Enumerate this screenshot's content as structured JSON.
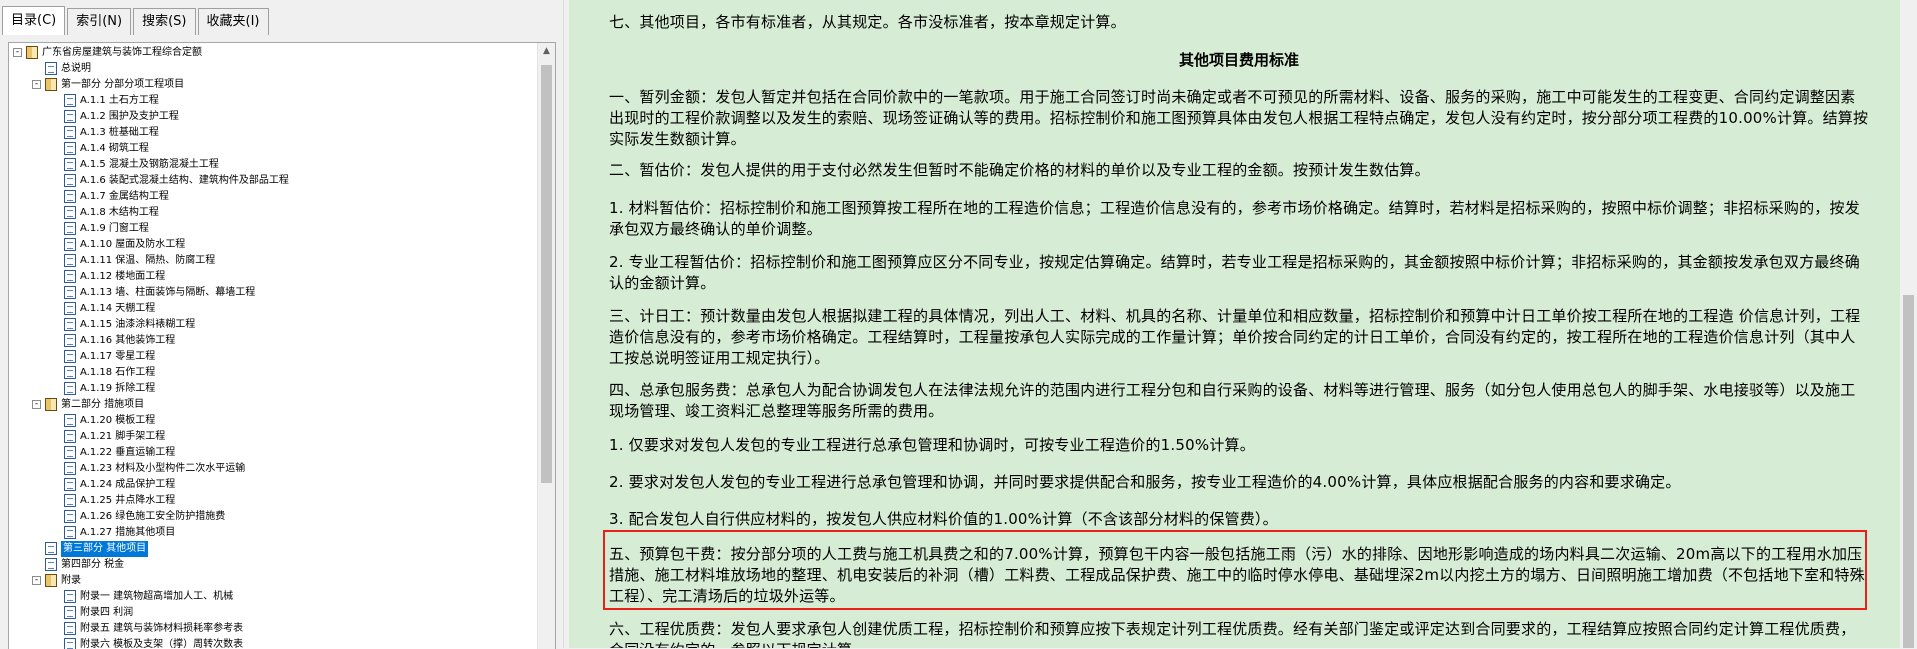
{
  "tabs": [
    {
      "label": "目录(C)"
    },
    {
      "label": "索引(N)"
    },
    {
      "label": "搜索(S)"
    },
    {
      "label": "收藏夹(I)"
    }
  ],
  "tree": [
    {
      "label": "广东省房屋建筑与装饰工程综合定额",
      "icon": "book",
      "expander": "-"
    },
    {
      "label": "总说明",
      "icon": "doc"
    },
    {
      "label": "第一部分 分部分项工程项目",
      "icon": "book",
      "expander": "-"
    },
    {
      "label": "A.1.1 土石方工程",
      "icon": "doc"
    },
    {
      "label": "A.1.2 围护及支护工程",
      "icon": "doc"
    },
    {
      "label": "A.1.3 桩基础工程",
      "icon": "doc"
    },
    {
      "label": "A.1.4 砌筑工程",
      "icon": "doc"
    },
    {
      "label": "A.1.5 混凝土及钢筋混凝土工程",
      "icon": "doc"
    },
    {
      "label": "A.1.6 装配式混凝土结构、建筑构件及部品工程",
      "icon": "doc"
    },
    {
      "label": "A.1.7 金属结构工程",
      "icon": "doc"
    },
    {
      "label": "A.1.8 木结构工程",
      "icon": "doc"
    },
    {
      "label": "A.1.9 门窗工程",
      "icon": "doc"
    },
    {
      "label": "A.1.10 屋面及防水工程",
      "icon": "doc"
    },
    {
      "label": "A.1.11 保温、隔热、防腐工程",
      "icon": "doc"
    },
    {
      "label": "A.1.12 楼地面工程",
      "icon": "doc"
    },
    {
      "label": "A.1.13 墙、柱面装饰与隔断、幕墙工程",
      "icon": "doc"
    },
    {
      "label": "A.1.14 天棚工程",
      "icon": "doc"
    },
    {
      "label": "A.1.15 油漆涂料裱糊工程",
      "icon": "doc"
    },
    {
      "label": "A.1.16 其他装饰工程",
      "icon": "doc"
    },
    {
      "label": "A.1.17 零星工程",
      "icon": "doc"
    },
    {
      "label": "A.1.18 石作工程",
      "icon": "doc"
    },
    {
      "label": "A.1.19 拆除工程",
      "icon": "doc"
    },
    {
      "label": "第二部分 措施项目",
      "icon": "book",
      "expander": "-"
    },
    {
      "label": "A.1.20 模板工程",
      "icon": "doc"
    },
    {
      "label": "A.1.21 脚手架工程",
      "icon": "doc"
    },
    {
      "label": "A.1.22 垂直运输工程",
      "icon": "doc"
    },
    {
      "label": "A.1.23 材料及小型构件二次水平运输",
      "icon": "doc"
    },
    {
      "label": "A.1.24 成品保护工程",
      "icon": "doc"
    },
    {
      "label": "A.1.25 井点降水工程",
      "icon": "doc"
    },
    {
      "label": "A.1.26 绿色施工安全防护措施费",
      "icon": "doc"
    },
    {
      "label": "A.1.27 措施其他项目",
      "icon": "doc"
    },
    {
      "label": "第三部分 其他项目",
      "icon": "doc",
      "selected": true
    },
    {
      "label": "第四部分 税金",
      "icon": "doc"
    },
    {
      "label": "附录",
      "icon": "book",
      "expander": "-"
    },
    {
      "label": "附录一 建筑物超高增加人工、机械",
      "icon": "doc"
    },
    {
      "label": "附录四 利润",
      "icon": "doc"
    },
    {
      "label": "附录五 建筑与装饰材料损耗率参考表",
      "icon": "doc"
    },
    {
      "label": "附录六 模板及支架（撑）周转次数表",
      "icon": "doc"
    }
  ],
  "content": {
    "intro": "七、其他项目，各市有标准者，从其规定。各市没标准者，按本章规定计算。",
    "heading": "其他项目费用标准",
    "p1": "一、暂列金额：发包人暂定并包括在合同价款中的一笔款项。用于施工合同签订时尚未确定或者不可预见的所需材料、设备、服务的采购，施工中可能发生的工程变更、合同约定调整因素出现时的工程价款调整以及发生的索赔、现场签证确认等的费用。招标控制价和施工图预算具体由发包人根据工程特点确定，发包人没有约定时，按分部分项工程费的10.00%计算。结算按实际发生数额计算。",
    "p2": "二、暂估价：发包人提供的用于支付必然发生但暂时不能确定价格的材料的单价以及专业工程的金额。按预计发生数估算。",
    "p3": "1. 材料暂估价：招标控制价和施工图预算按工程所在地的工程造价信息；工程造价信息没有的，参考市场价格确定。结算时，若材料是招标采购的，按照中标价调整；非招标采购的，按发承包双方最终确认的单价调整。",
    "p4": "2. 专业工程暂估价：招标控制价和施工图预算应区分不同专业，按规定估算确定。结算时，若专业工程是招标采购的，其金额按照中标价计算；非招标采购的，其金额按发承包双方最终确认的金额计算。",
    "p5": "三、计日工：预计数量由发包人根据拟建工程的具体情况，列出人工、材料、机具的名称、计量单位和相应数量，招标控制价和预算中计日工单价按工程所在地的工程造 价信息计列，工程造价信息没有的，参考市场价格确定。工程结算时，工程量按承包人实际完成的工作量计算；单价按合同约定的计日工单价，合同没有约定的，按工程所在地的工程造价信息计列（其中人工按总说明签证用工规定执行）。",
    "p6": "四、总承包服务费：总承包人为配合协调发包人在法律法规允许的范围内进行工程分包和自行采购的设备、材料等进行管理、服务（如分包人使用总包人的脚手架、水电接驳等）以及施工现场管理、竣工资料汇总整理等服务所需的费用。",
    "p7": "1. 仅要求对发包人发包的专业工程进行总承包管理和协调时，可按专业工程造价的1.50%计算。",
    "p8": "2. 要求对发包人发包的专业工程进行总承包管理和协调，并同时要求提供配合和服务，按专业工程造价的4.00%计算，具体应根据配合服务的内容和要求确定。",
    "p9": "3. 配合发包人自行供应材料的，按发包人供应材料价值的1.00%计算（不含该部分材料的保管费）。",
    "p10": "五、预算包干费：按分部分项的人工费与施工机具费之和的7.00%计算，预算包干内容一般包括施工雨（污）水的排除、因地形影响造成的场内料具二次运输、20m高以下的工程用水加压措施、施工材料堆放场地的整理、机电安装后的补洞（槽）工料费、工程成品保护费、施工中的临时停水停电、基础埋深2m以内挖土方的塌方、日间照明施工增加费（不包括地下室和特殊工程）、完工清场后的垃圾外运等。",
    "p11": "六、工程优质费：发包人要求承包人创建优质工程，招标控制价和预算应按下表规定计列工程优质费。经有关部门鉴定或评定达到合同要求的，工程结算应按照合同约定计算工程优质费，合同没有约定的，参照以下规定计算。"
  },
  "colors": {
    "content_bg": "#d6ecd4",
    "highlight_border": "#e8211b",
    "selection": "#0078d7"
  }
}
